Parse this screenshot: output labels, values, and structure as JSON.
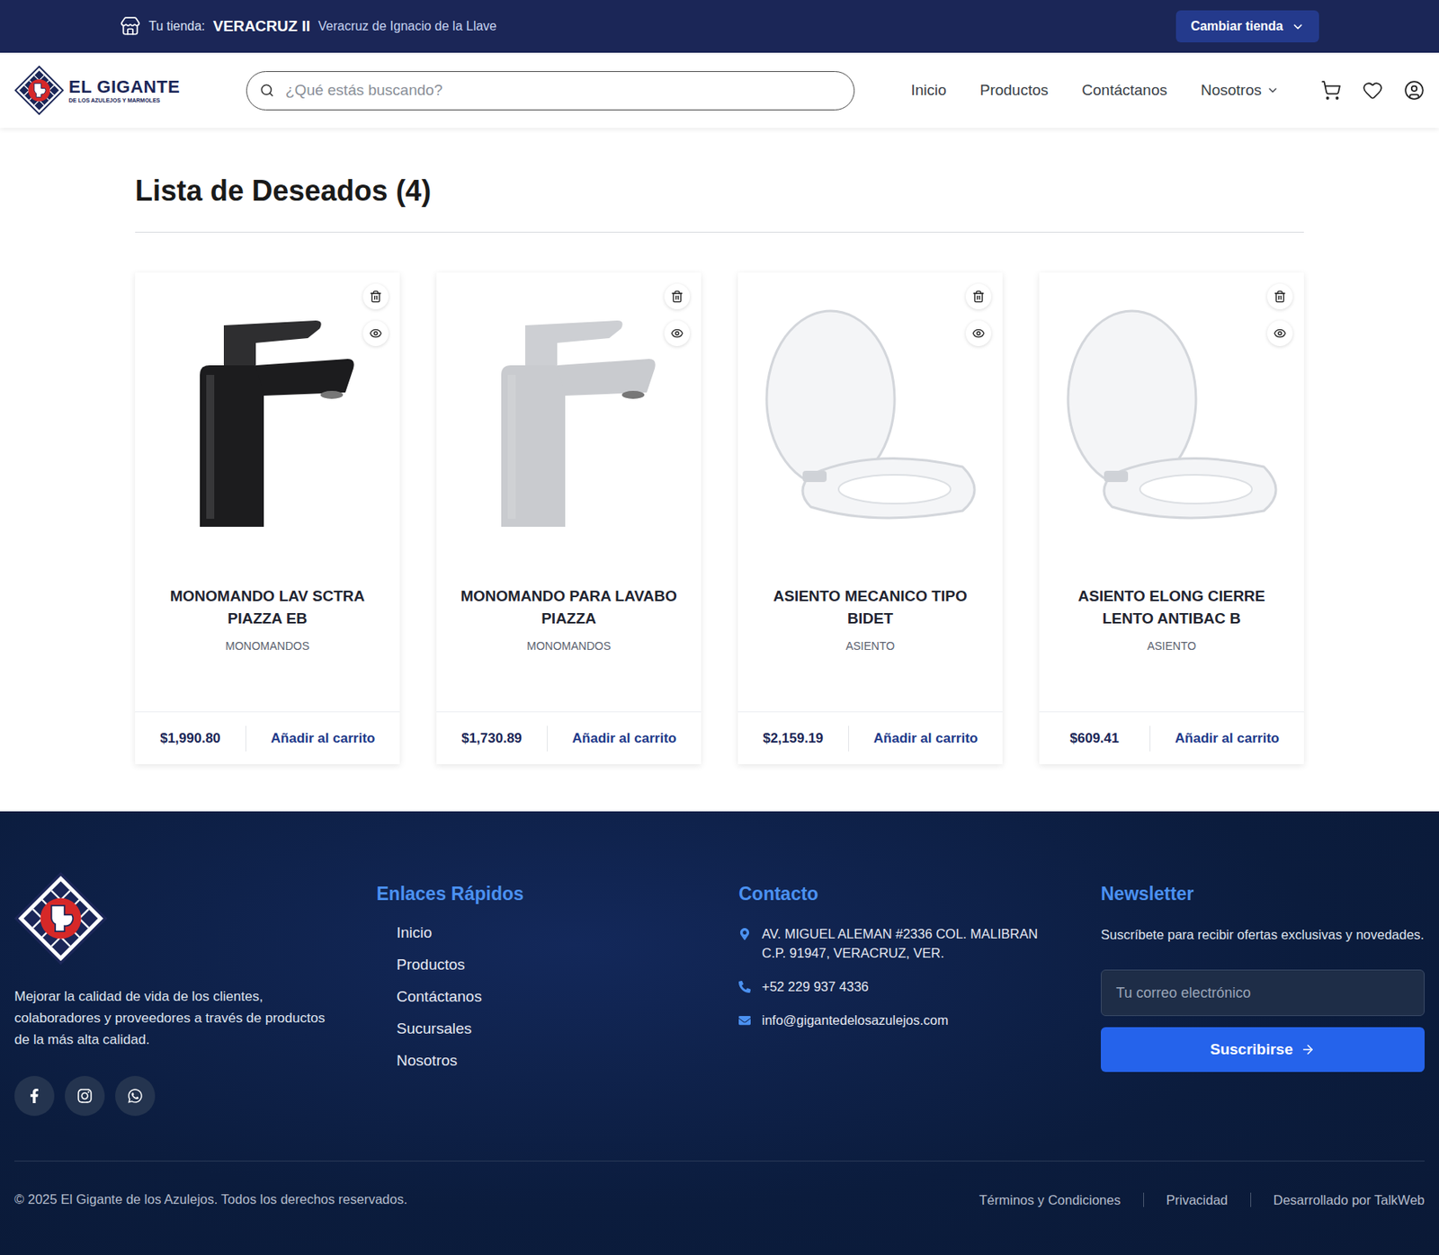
{
  "store_bar": {
    "label": "Tu tienda:",
    "store": "VERACRUZ II",
    "state": "Veracruz de Ignacio de la Llave",
    "button": "Cambiar tienda"
  },
  "header": {
    "logo_title": "EL GIGANTE",
    "logo_subtitle": "DE LOS AZULEJOS Y MARMOLES",
    "search_placeholder": "¿Qué estás buscando?",
    "nav": [
      {
        "label": "Inicio",
        "dropdown": false
      },
      {
        "label": "Productos",
        "dropdown": false
      },
      {
        "label": "Contáctanos",
        "dropdown": false
      },
      {
        "label": "Nosotros",
        "dropdown": true
      }
    ]
  },
  "page": {
    "title": "Lista de Deseados (4)"
  },
  "products": [
    {
      "name": "MONOMANDO LAV SCTRA PIAZZA EB",
      "category": "MONOMANDOS",
      "price": "$1,990.80",
      "action": "Añadir al carrito",
      "kind": "faucet",
      "color": "#1c1c1e"
    },
    {
      "name": "MONOMANDO PARA LAVABO PIAZZA",
      "category": "MONOMANDOS",
      "price": "$1,730.89",
      "action": "Añadir al carrito",
      "kind": "faucet",
      "color": "#c9cbcf"
    },
    {
      "name": "ASIENTO MECANICO TIPO BIDET",
      "category": "ASIENTO",
      "price": "$2,159.19",
      "action": "Añadir al carrito",
      "kind": "seat",
      "color": "#f4f5f7"
    },
    {
      "name": "ASIENTO ELONG CIERRE LENTO ANTIBAC B",
      "category": "ASIENTO",
      "price": "$609.41",
      "action": "Añadir al carrito",
      "kind": "seat",
      "color": "#f4f5f7"
    }
  ],
  "footer": {
    "mission": "Mejorar la calidad de vida de los clientes, colaboradores y proveedores a través de productos de la más alta calidad.",
    "links_title": "Enlaces Rápidos",
    "links": [
      "Inicio",
      "Productos",
      "Contáctanos",
      "Sucursales",
      "Nosotros"
    ],
    "contact_title": "Contacto",
    "contact": [
      {
        "kind": "address",
        "text": "AV. MIGUEL ALEMAN #2336 COL. MALIBRAN C.P. 91947, VERACRUZ, VER."
      },
      {
        "kind": "phone",
        "text": "+52 229 937 4336"
      },
      {
        "kind": "email",
        "text": "info@gigantedelosazulejos.com"
      }
    ],
    "newsletter_title": "Newsletter",
    "newsletter_text": "Suscríbete para recibir ofertas exclusivas y novedades.",
    "newsletter_placeholder": "Tu correo electrónico",
    "newsletter_button": "Suscribirse",
    "copyright": "© 2025 El Gigante de los Azulejos. Todos los derechos reservados.",
    "legal": [
      "Términos y Condiciones",
      "Privacidad",
      "Desarrollado por TalkWeb"
    ]
  }
}
